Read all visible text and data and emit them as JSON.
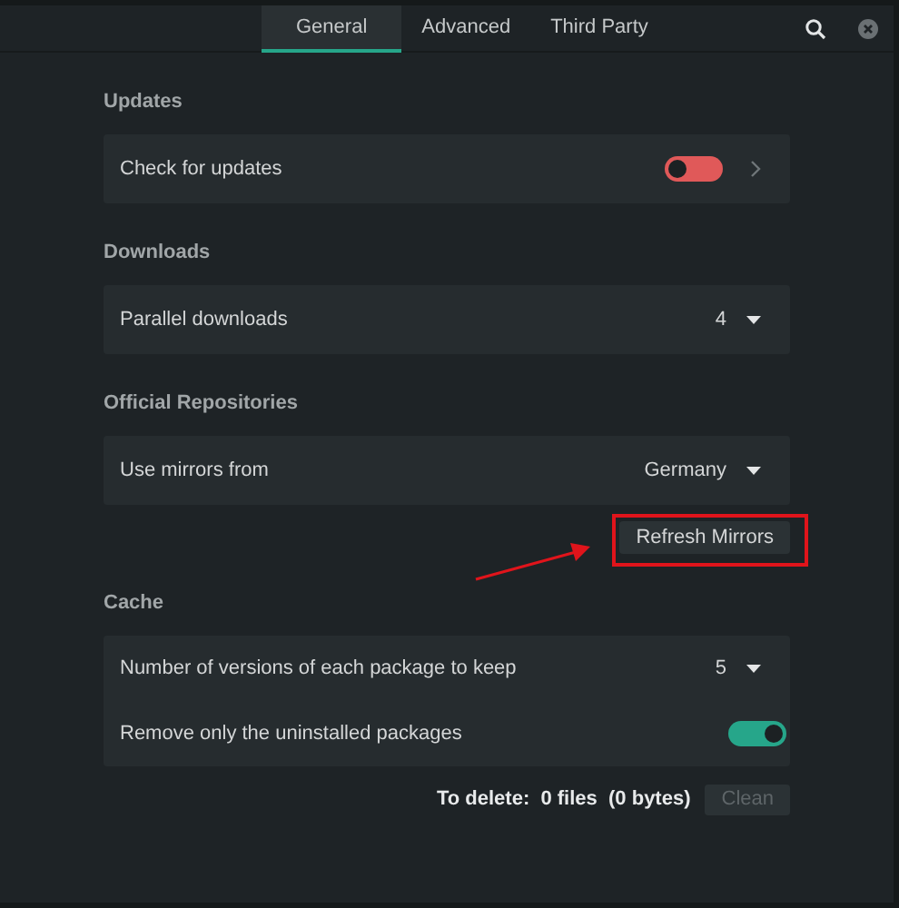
{
  "tabs": [
    {
      "label": "General",
      "selected": true
    },
    {
      "label": "Advanced",
      "selected": false
    },
    {
      "label": "Third Party",
      "selected": false
    }
  ],
  "sections": [
    {
      "title": "Updates",
      "rows": [
        {
          "kind": "toggle",
          "label": "Check for updates",
          "on": false,
          "has_details": true
        }
      ]
    },
    {
      "title": "Downloads",
      "rows": [
        {
          "kind": "dropdown",
          "label": "Parallel downloads",
          "value": "4"
        }
      ]
    },
    {
      "title": "Official Repositories",
      "rows": [
        {
          "kind": "dropdown",
          "label": "Use mirrors from",
          "value": "Germany"
        }
      ],
      "button": {
        "label": "Refresh Mirrors",
        "highlighted": true
      }
    },
    {
      "title": "Cache",
      "rows": [
        {
          "kind": "dropdown",
          "label": "Number of versions of each package to keep",
          "value": "5"
        },
        {
          "kind": "toggle",
          "label": "Remove only the uninstalled packages",
          "on": true,
          "has_details": false
        }
      ],
      "footer": {
        "summary": "To delete:  0 files  (0 bytes)",
        "button": {
          "label": "Clean",
          "disabled": true
        }
      }
    }
  ]
}
